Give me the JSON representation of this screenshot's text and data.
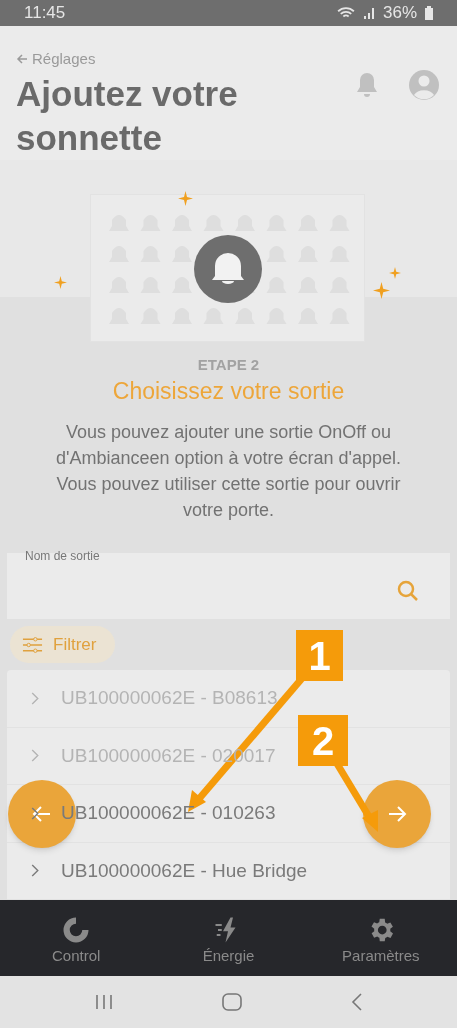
{
  "status_bar": {
    "time": "11:45",
    "battery": "36%"
  },
  "header": {
    "back_link": "Réglages",
    "title": "Ajoutez votre sonnette"
  },
  "step": {
    "label": "ETAPE 2",
    "title": "Choisissez votre sortie",
    "description": "Vous pouvez ajouter une sortie OnOff ou d'Ambianceen option à votre écran d'appel. Vous pouvez utiliser cette sortie pour ouvrir votre porte."
  },
  "search": {
    "label": "Nom de sortie"
  },
  "filter_button": {
    "label": "Filtrer"
  },
  "outputs": [
    {
      "label": "UB100000062E - B08613",
      "disabled": true
    },
    {
      "label": "UB100000062E - 020017",
      "disabled": true
    },
    {
      "label": "UB100000062E - 010263",
      "disabled": false
    },
    {
      "label": "UB100000062E - Hue Bridge",
      "disabled": false
    }
  ],
  "nav": {
    "tabs": [
      {
        "kind": "control",
        "label": "Control"
      },
      {
        "kind": "energy",
        "label": "Énergie"
      },
      {
        "kind": "settings",
        "label": "Paramètres"
      }
    ]
  },
  "annotations": [
    {
      "number": "1"
    },
    {
      "number": "2"
    }
  ]
}
